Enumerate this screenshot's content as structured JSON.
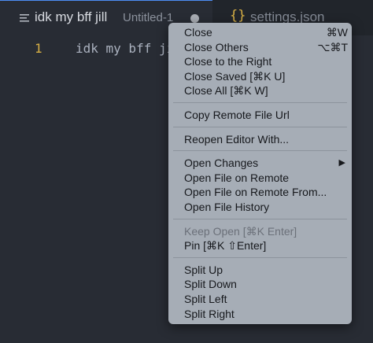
{
  "tabs": {
    "active": {
      "title": "idk my bff jill",
      "description": "Untitled-1",
      "icon": "menu-lines-icon"
    },
    "inactive": {
      "title": "settings.json",
      "icon": "braces-icon"
    }
  },
  "editor": {
    "line_number": "1",
    "code": "idk my bff jill"
  },
  "context_menu": {
    "close": "Close",
    "close_shortcut": "⌘W",
    "close_others": "Close Others",
    "close_others_shortcut": "⌥⌘T",
    "close_right": "Close to the Right",
    "close_saved": "Close Saved [⌘K U]",
    "close_all": "Close All [⌘K W]",
    "copy_remote_url": "Copy Remote File Url",
    "reopen_with": "Reopen Editor With...",
    "open_changes": "Open Changes",
    "open_on_remote": "Open File on Remote",
    "open_on_remote_from": "Open File on Remote From...",
    "open_history": "Open File History",
    "keep_open": "Keep Open [⌘K Enter]",
    "pin": "Pin [⌘K ⇧Enter]",
    "split_up": "Split Up",
    "split_down": "Split Down",
    "split_left": "Split Left",
    "split_right": "Split Right"
  },
  "colors": {
    "accent": "#4d8ef5",
    "line_number": "#d8b045",
    "menu_bg": "#a6adb6"
  }
}
